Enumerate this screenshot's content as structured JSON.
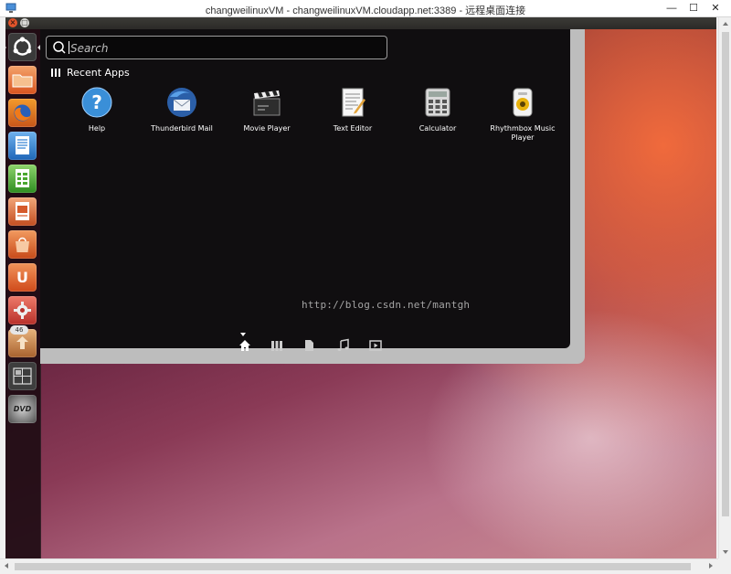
{
  "window": {
    "title": "changweilinuxVM - changweilinuxVM.cloudapp.net:3389 - 远程桌面连接",
    "minimize_glyph": "—",
    "maximize_glyph": "☐",
    "close_glyph": "✕"
  },
  "ubuntu_panel": {
    "close_glyph": "×",
    "maximize_glyph": "□"
  },
  "launcher": {
    "items": [
      {
        "name": "dash-home",
        "icon": "ubuntu-logo-icon",
        "color": "#3a3a3a"
      },
      {
        "name": "files",
        "icon": "folder-icon",
        "color": "#e86a2c"
      },
      {
        "name": "firefox",
        "icon": "firefox-icon",
        "color": "#e87d1d"
      },
      {
        "name": "libreoffice-writer",
        "icon": "writer-icon",
        "color": "#2f7fd1"
      },
      {
        "name": "libreoffice-calc",
        "icon": "calc-icon",
        "color": "#4aa72f"
      },
      {
        "name": "libreoffice-impress",
        "icon": "impress-icon",
        "color": "#d55a2c"
      },
      {
        "name": "software-center",
        "icon": "shopping-bag-icon",
        "color": "#e0642a"
      },
      {
        "name": "ubuntu-one",
        "icon": "ubuntu-one-icon",
        "color": "#e5612a",
        "glyph": "U"
      },
      {
        "name": "system-settings",
        "icon": "gear-icon",
        "color": "#d84b3a"
      },
      {
        "name": "update-manager",
        "icon": "update-icon",
        "color": "#c9844f",
        "badge": "46"
      },
      {
        "name": "workspace-switcher",
        "icon": "workspaces-icon",
        "color": "#3e3e3e"
      },
      {
        "name": "dvd",
        "icon": "dvd-icon",
        "color": "#555555",
        "glyph": "DVD"
      }
    ]
  },
  "dash": {
    "search": {
      "placeholder": "Search",
      "value": ""
    },
    "section_title": "Recent Apps",
    "apps": [
      {
        "label": "Help",
        "icon": "help-icon"
      },
      {
        "label": "Thunderbird Mail",
        "icon": "thunderbird-icon"
      },
      {
        "label": "Movie Player",
        "icon": "clapperboard-icon"
      },
      {
        "label": "Text Editor",
        "icon": "text-editor-icon"
      },
      {
        "label": "Calculator",
        "icon": "calculator-icon"
      },
      {
        "label": "Rhythmbox Music Player",
        "icon": "rhythmbox-icon"
      }
    ],
    "watermark": "http://blog.csdn.net/mantgh",
    "lenses": [
      {
        "name": "home",
        "icon": "home-icon",
        "active": true
      },
      {
        "name": "applications",
        "icon": "applications-icon"
      },
      {
        "name": "files",
        "icon": "file-icon"
      },
      {
        "name": "music",
        "icon": "music-note-icon"
      },
      {
        "name": "video",
        "icon": "video-icon"
      }
    ]
  },
  "colors": {
    "launcher_bg": "#1e0c14",
    "dash_bg": "#080608",
    "ubuntu_orange": "#e2542b"
  }
}
